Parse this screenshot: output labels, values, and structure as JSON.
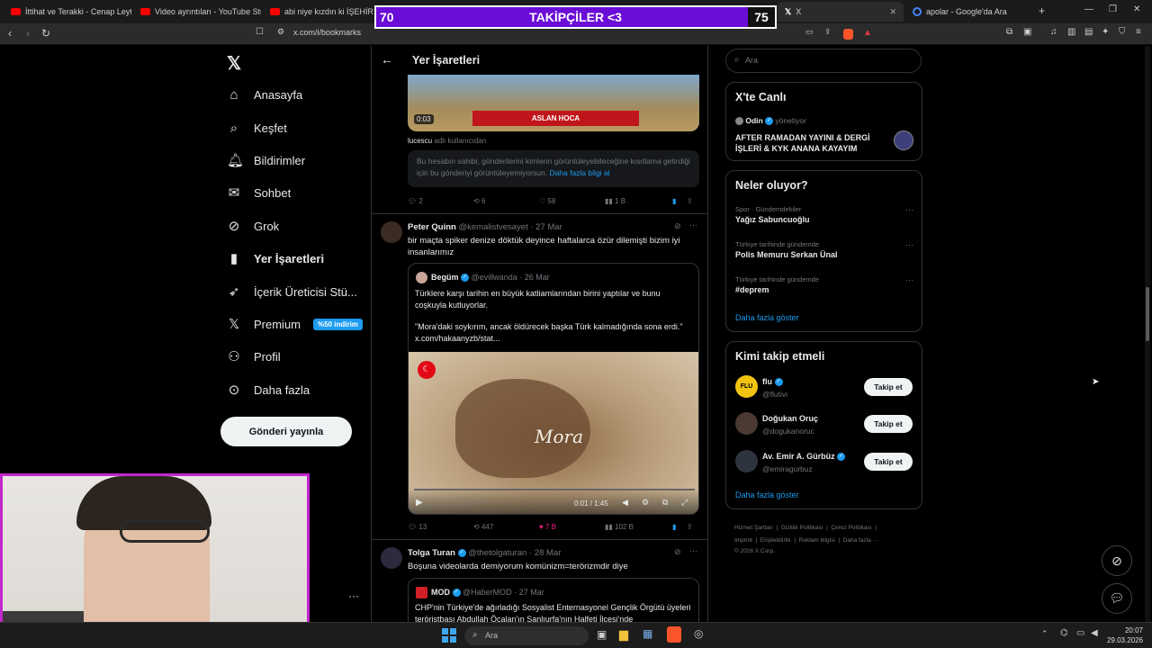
{
  "browser": {
    "tabs": [
      {
        "label": "İttihat ve Terakki - Cenap Leyteneo"
      },
      {
        "label": "Video ayrıntıları - YouTube Studio"
      },
      {
        "label": "abi niye kızdın ki İŞEHİR BULMACA"
      },
      {
        "label": "X"
      },
      {
        "label": "apolar - Google'da Ara"
      }
    ],
    "url": "x.com/i/bookmarks"
  },
  "overlay": {
    "left_num": "70",
    "title": "TAKİPÇİLER <3",
    "right_num": "75"
  },
  "sidebar": {
    "items": [
      {
        "label": "Anasayfa",
        "icon": "home-icon"
      },
      {
        "label": "Keşfet",
        "icon": "search-icon"
      },
      {
        "label": "Bildirimler",
        "icon": "bell-icon"
      },
      {
        "label": "Sohbet",
        "icon": "mail-icon"
      },
      {
        "label": "Grok",
        "icon": "grok-icon"
      },
      {
        "label": "Yer İşaretleri",
        "icon": "bookmark-icon"
      },
      {
        "label": "İçerik Üreticisi Stü...",
        "icon": "rocket-icon"
      },
      {
        "label": "Premium",
        "icon": "x-logo-icon",
        "badge": "%50 indirim"
      },
      {
        "label": "Profil",
        "icon": "person-icon"
      },
      {
        "label": "Daha fazla",
        "icon": "more-icon"
      }
    ],
    "post_button": "Gönderi yayınla"
  },
  "main": {
    "header": "Yer İşaretleri",
    "tweet1": {
      "video_time": "0:03",
      "video_caption": "ASLAN HOCA",
      "username": "lucescu",
      "username_suffix": "adlı kullanıcıdan",
      "notice": "Bu hesabın sahibi, gönderilerini kimlerin görüntüleyebileceğine kısıtlama getirdiği için bu gönderiyi görüntüleyemiyorsun.",
      "notice_link": "Daha fazla bilgi al",
      "replies": "2",
      "retweets": "6",
      "likes": "58",
      "views": "1 B"
    },
    "tweet2": {
      "name": "Peter Quinn",
      "handle": "@kemalistvesayet",
      "date": "· 27 Mar",
      "text": "bir maçta spiker denize döktük deyince haftalarca özür dilemişti bizim iyi insanlarımız",
      "quote_name": "Begüm",
      "quote_handle": "@evillwanda",
      "quote_date": "· 26 Mar",
      "quote_text1": "Türklere karşı tarihin en büyük katliamlarından birini yaptılar ve bunu coşkuyla kutluyorlar.",
      "quote_text2": "\"Mora'daki soykırım, ancak öldürecek başka Türk kalmadığında sona erdi.\" x.com/hakaanyzb/stat...",
      "map_label": "Mora",
      "video_time": "0:01 / 1:45",
      "replies": "13",
      "retweets": "447",
      "likes": "7 B",
      "views": "102 B"
    },
    "tweet3": {
      "name": "Tolga Turan",
      "handle": "@thetolgaturan",
      "date": "· 28 Mar",
      "text": "Boşuna videolarda demiyorum komünizm=terörizmdir diye",
      "quote_name": "MOD",
      "quote_handle": "@HaberMOD",
      "quote_date": "· 27 Mar",
      "quote_text": "CHP'nin Türkiye'de ağırladığı Sosyalist Enternasyonel Gençlik Örgütü üyeleri teröristbaşı Abdullah Öcalan'ın Şanlıurfa'nın Halfeti İlçesi'nde"
    }
  },
  "right": {
    "search_placeholder": "Ara",
    "live": {
      "title": "X'te Canlı",
      "host": "Odin",
      "host_role": "yönetiyor",
      "stream_title": "AFTER RAMADAN YAYINI & DERGİ İŞLERİ & KYK ANANA KAYAYIM"
    },
    "trends": {
      "title": "Neler oluyor?",
      "items": [
        {
          "context": "Spor · Gündemdekiler",
          "name": "Yağız Sabuncuoğlu"
        },
        {
          "context": "Türkiye tarihinde gündemde",
          "name": "Polis Memuru Serkan Ünal"
        },
        {
          "context": "Türkiye tarihinde gündemde",
          "name": "#deprem"
        }
      ],
      "show_more": "Daha fazla göster"
    },
    "who_to_follow": {
      "title": "Kimi takip etmeli",
      "users": [
        {
          "name": "flu",
          "handle": "@flutivi",
          "button": "Takip et"
        },
        {
          "name": "Doğukan Oruç",
          "handle": "@dogukanoruc",
          "button": "Takip et"
        },
        {
          "name": "Av. Emir A. Gürbüz",
          "handle": "@emiragurbuz",
          "button": "Takip et"
        }
      ],
      "show_more": "Daha fazla göster"
    },
    "footer": {
      "line1": [
        "Hizmet Şartları",
        "Gizlilik Politikası",
        "Çerez Politikası"
      ],
      "line2": [
        "Imprint",
        "Erişilebilirlik",
        "Reklam bilgisi",
        "Daha fazla ···"
      ],
      "copyright": "© 2026 X Corp."
    }
  },
  "taskbar": {
    "search_placeholder": "Ara",
    "time": "20:07",
    "date": "29.03.2026"
  },
  "colors": {
    "accent": "#1d9bf0",
    "overlay": "#6a0dd6",
    "webcam_border": "#c227ce",
    "like": "#f91880"
  }
}
